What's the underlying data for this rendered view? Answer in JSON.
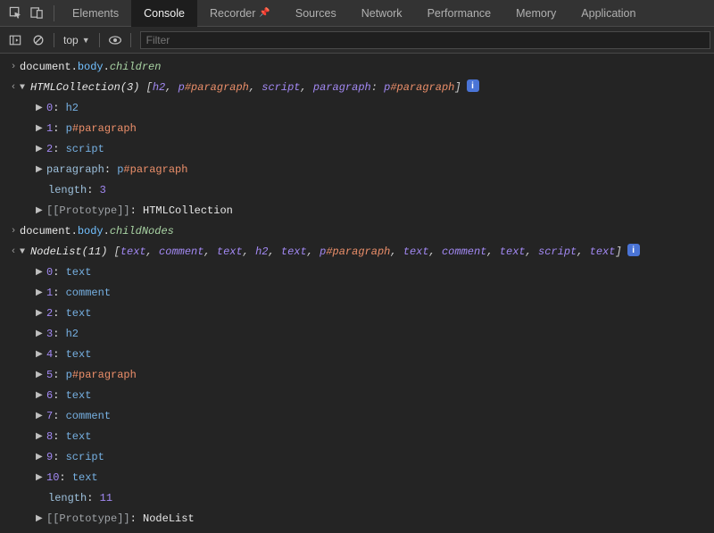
{
  "tabs": {
    "inspect_icon": "inspect",
    "device_icon": "device",
    "items": [
      {
        "label": "Elements",
        "active": false,
        "pin": false
      },
      {
        "label": "Console",
        "active": true,
        "pin": false
      },
      {
        "label": "Recorder",
        "active": false,
        "pin": true
      },
      {
        "label": "Sources",
        "active": false,
        "pin": false
      },
      {
        "label": "Network",
        "active": false,
        "pin": false
      },
      {
        "label": "Performance",
        "active": false,
        "pin": false
      },
      {
        "label": "Memory",
        "active": false,
        "pin": false
      },
      {
        "label": "Application",
        "active": false,
        "pin": false
      }
    ]
  },
  "toolbar": {
    "context": "top",
    "filter_placeholder": "Filter"
  },
  "entries": {
    "e1": {
      "input_prefix": "document",
      "input_mid": "body",
      "input_prop": "children",
      "result_type": "HTMLCollection",
      "count": "3",
      "preview": [
        {
          "el": "h2"
        },
        {
          "el": "p",
          "id": "#paragraph"
        },
        {
          "el": "script"
        },
        {
          "label": "paragraph",
          "el": "p",
          "id": "#paragraph"
        }
      ],
      "items": [
        {
          "k": "0",
          "el": "h2"
        },
        {
          "k": "1",
          "el": "p",
          "id": "#paragraph"
        },
        {
          "k": "2",
          "el": "script"
        },
        {
          "k": "paragraph",
          "el": "p",
          "id": "#paragraph"
        }
      ],
      "length": "3",
      "proto": "HTMLCollection"
    },
    "e2": {
      "input_prefix": "document",
      "input_mid": "body",
      "input_prop": "childNodes",
      "result_type": "NodeList",
      "count": "11",
      "preview": [
        "text",
        "comment",
        "text",
        "h2",
        "text",
        {
          "el": "p",
          "id": "#paragraph"
        },
        "text",
        "comment",
        "text",
        "script",
        "text"
      ],
      "items": [
        {
          "k": "0",
          "el": "text"
        },
        {
          "k": "1",
          "el": "comment"
        },
        {
          "k": "2",
          "el": "text"
        },
        {
          "k": "3",
          "el": "h2"
        },
        {
          "k": "4",
          "el": "text"
        },
        {
          "k": "5",
          "el": "p",
          "id": "#paragraph"
        },
        {
          "k": "6",
          "el": "text"
        },
        {
          "k": "7",
          "el": "comment"
        },
        {
          "k": "8",
          "el": "text"
        },
        {
          "k": "9",
          "el": "script"
        },
        {
          "k": "10",
          "el": "text"
        }
      ],
      "length": "11",
      "proto": "NodeList"
    }
  },
  "labels": {
    "length": "length",
    "proto": "[[Prototype]]"
  }
}
